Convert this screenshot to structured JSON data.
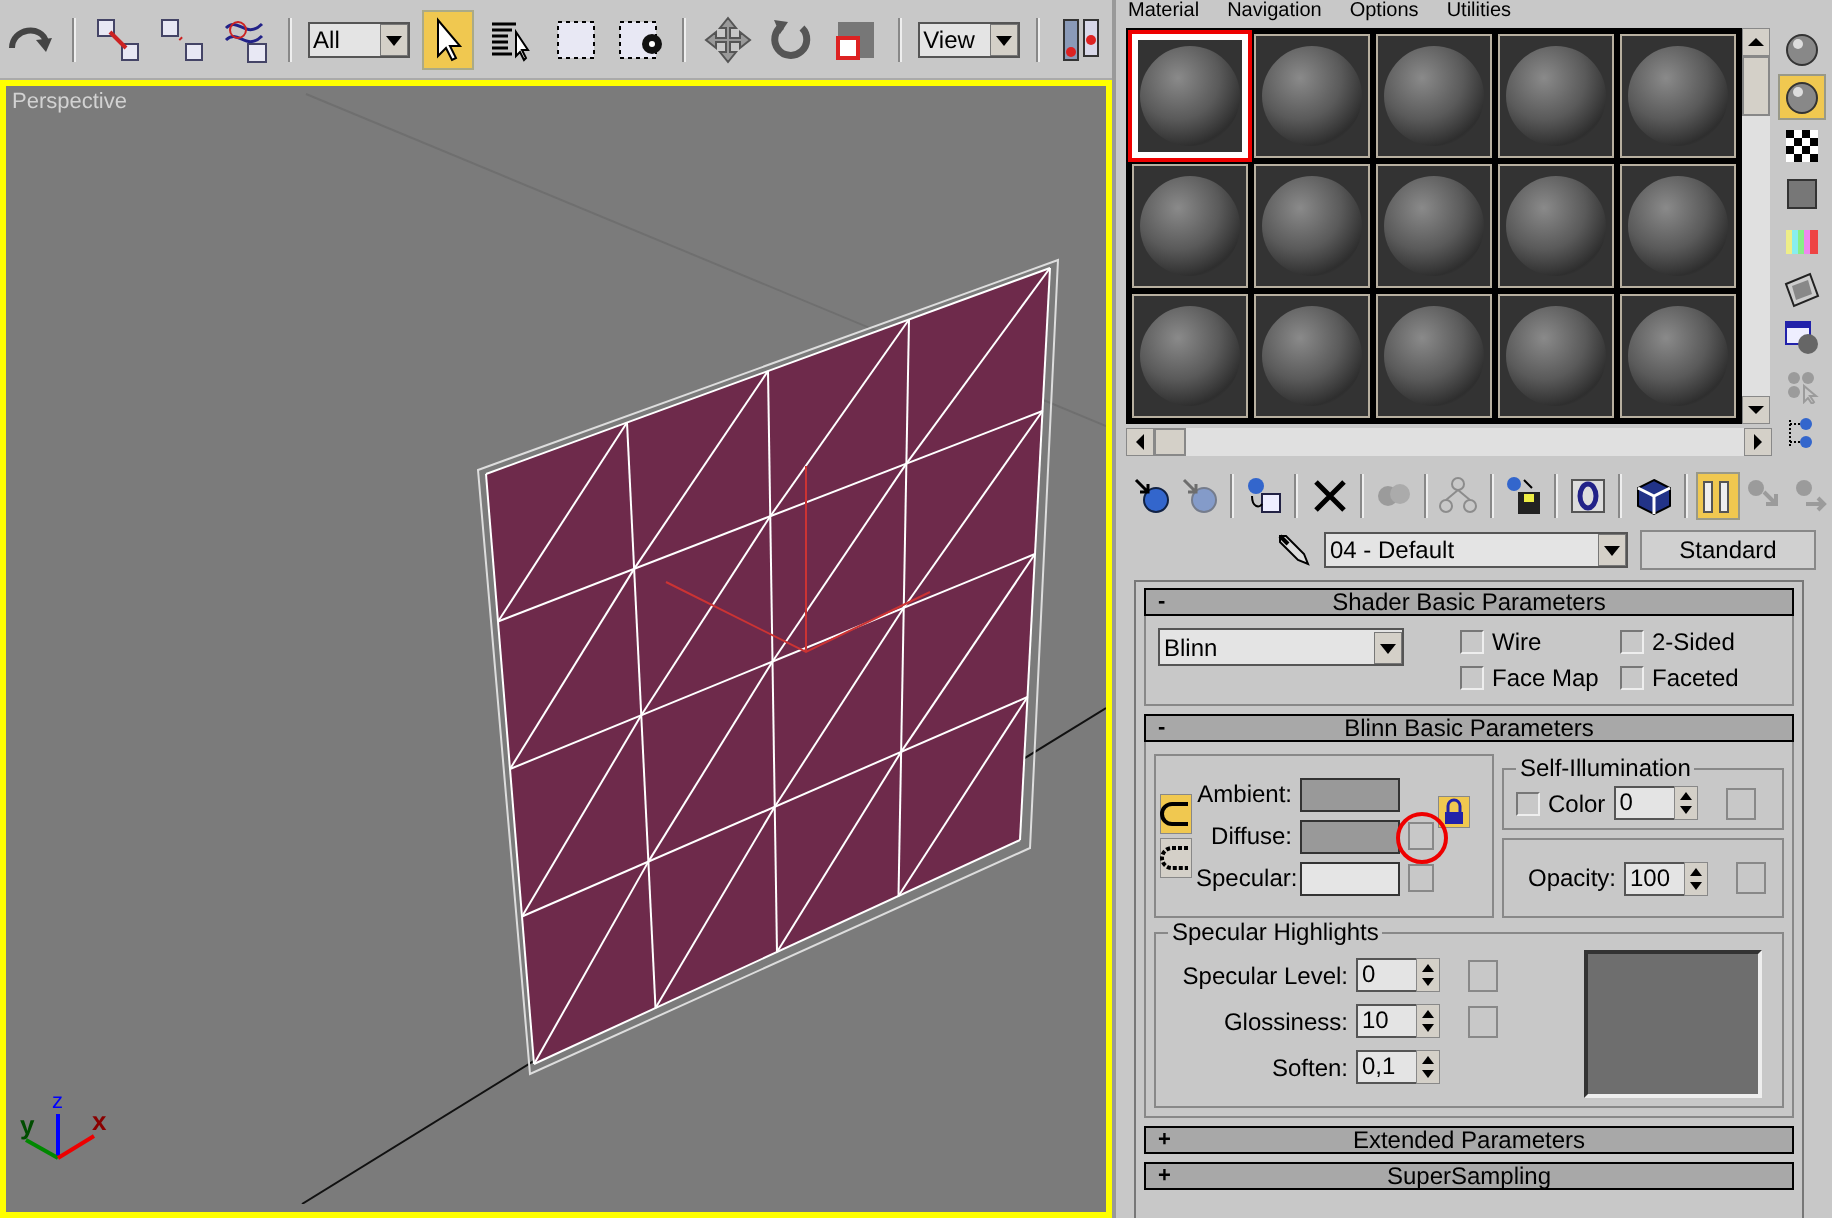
{
  "toolbar": {
    "items": [
      {
        "kind": "undo",
        "selected": false
      },
      {
        "kind": "link",
        "selected": false
      },
      {
        "kind": "unlink",
        "selected": false
      },
      {
        "kind": "bind",
        "selected": false
      },
      {
        "kind": "filter",
        "value": "All"
      },
      {
        "kind": "select",
        "selected": true
      },
      {
        "kind": "select-by-name",
        "selected": false
      },
      {
        "kind": "region",
        "selected": false
      },
      {
        "kind": "crossing",
        "selected": false
      },
      {
        "kind": "move",
        "selected": false
      },
      {
        "kind": "rotate",
        "selected": false
      },
      {
        "kind": "scale",
        "selected": false
      },
      {
        "kind": "coord",
        "value": "View"
      },
      {
        "kind": "pivot",
        "selected": false
      }
    ]
  },
  "viewport": {
    "label": "Perspective",
    "axes": {
      "z": "z",
      "y": "y",
      "x": "x"
    }
  },
  "material_editor": {
    "menu": [
      "Material",
      "Navigation",
      "Options",
      "Utilities"
    ],
    "sample_slots": [
      {
        "selected": true,
        "circled": true
      },
      {
        "selected": false,
        "circled": false
      },
      {
        "selected": false,
        "circled": false
      },
      {
        "selected": false,
        "circled": false
      },
      {
        "selected": false,
        "circled": false
      },
      {
        "selected": false,
        "circled": false
      },
      {
        "selected": false,
        "circled": false
      },
      {
        "selected": false,
        "circled": false
      },
      {
        "selected": false,
        "circled": false
      },
      {
        "selected": false,
        "circled": false
      },
      {
        "selected": false,
        "circled": false
      },
      {
        "selected": false,
        "circled": false
      },
      {
        "selected": false,
        "circled": false
      },
      {
        "selected": false,
        "circled": false
      },
      {
        "selected": false,
        "circled": false
      }
    ],
    "side_tools": [
      {
        "kind": "sample-type",
        "selected": false,
        "disabled": false
      },
      {
        "kind": "backlight",
        "selected": true,
        "disabled": false
      },
      {
        "kind": "background",
        "selected": false,
        "disabled": false
      },
      {
        "kind": "tiling",
        "selected": false,
        "disabled": false
      },
      {
        "kind": "color-check",
        "selected": false,
        "disabled": false
      },
      {
        "kind": "preview",
        "selected": false,
        "disabled": false
      },
      {
        "kind": "options",
        "selected": false,
        "disabled": false
      },
      {
        "kind": "select-by-material",
        "selected": false,
        "disabled": true
      },
      {
        "kind": "navigator",
        "selected": false,
        "disabled": false
      }
    ],
    "bottom_tools": [
      {
        "kind": "get",
        "selected": false,
        "disabled": false
      },
      {
        "kind": "put",
        "selected": false,
        "disabled": true
      },
      {
        "kind": "assign",
        "selected": false,
        "disabled": false
      },
      {
        "kind": "reset",
        "selected": false,
        "disabled": false
      },
      {
        "kind": "copy",
        "selected": false,
        "disabled": true
      },
      {
        "kind": "unique",
        "selected": false,
        "disabled": true
      },
      {
        "kind": "library",
        "selected": false,
        "disabled": false
      },
      {
        "kind": "channel",
        "selected": false,
        "disabled": false
      },
      {
        "kind": "show-map",
        "selected": false,
        "disabled": false
      },
      {
        "kind": "end-result",
        "selected": true,
        "disabled": false
      },
      {
        "kind": "parent",
        "selected": false,
        "disabled": true
      },
      {
        "kind": "sibling",
        "selected": false,
        "disabled": true
      }
    ],
    "material_name": "04 - Default",
    "material_type": "Standard",
    "shader_rollout": {
      "toggle": "-",
      "title": "Shader Basic Parameters",
      "shader": "Blinn",
      "options": [
        {
          "label": "Wire",
          "checked": false
        },
        {
          "label": "2-Sided",
          "checked": false
        },
        {
          "label": "Face Map",
          "checked": false
        },
        {
          "label": "Faceted",
          "checked": false
        }
      ]
    },
    "blinn_rollout": {
      "toggle": "-",
      "title": "Blinn Basic Parameters",
      "colors": [
        {
          "label": "Ambient:",
          "color": "#999999",
          "map_button": false,
          "circled": false
        },
        {
          "label": "Diffuse:",
          "color": "#999999",
          "map_button": true,
          "circled": true
        },
        {
          "label": "Specular:",
          "color": "#e5e5e5",
          "map_button": true,
          "circled": false
        }
      ],
      "lock_checked": true,
      "self_illumination": {
        "title": "Self-Illumination",
        "color_checked": false,
        "label": "Color",
        "value": "0"
      },
      "opacity": {
        "label": "Opacity:",
        "value": "100"
      },
      "specular_highlights": {
        "title": "Specular Highlights",
        "rows": [
          {
            "label": "Specular Level:",
            "value": "0",
            "map_button": true
          },
          {
            "label": "Glossiness:",
            "value": "10",
            "map_button": true
          },
          {
            "label": "Soften:",
            "value": "0,1",
            "map_button": false
          }
        ]
      }
    },
    "collapsed_rollouts": [
      {
        "toggle": "+",
        "title": "Extended Parameters"
      },
      {
        "toggle": "+",
        "title": "SuperSampling"
      }
    ]
  }
}
